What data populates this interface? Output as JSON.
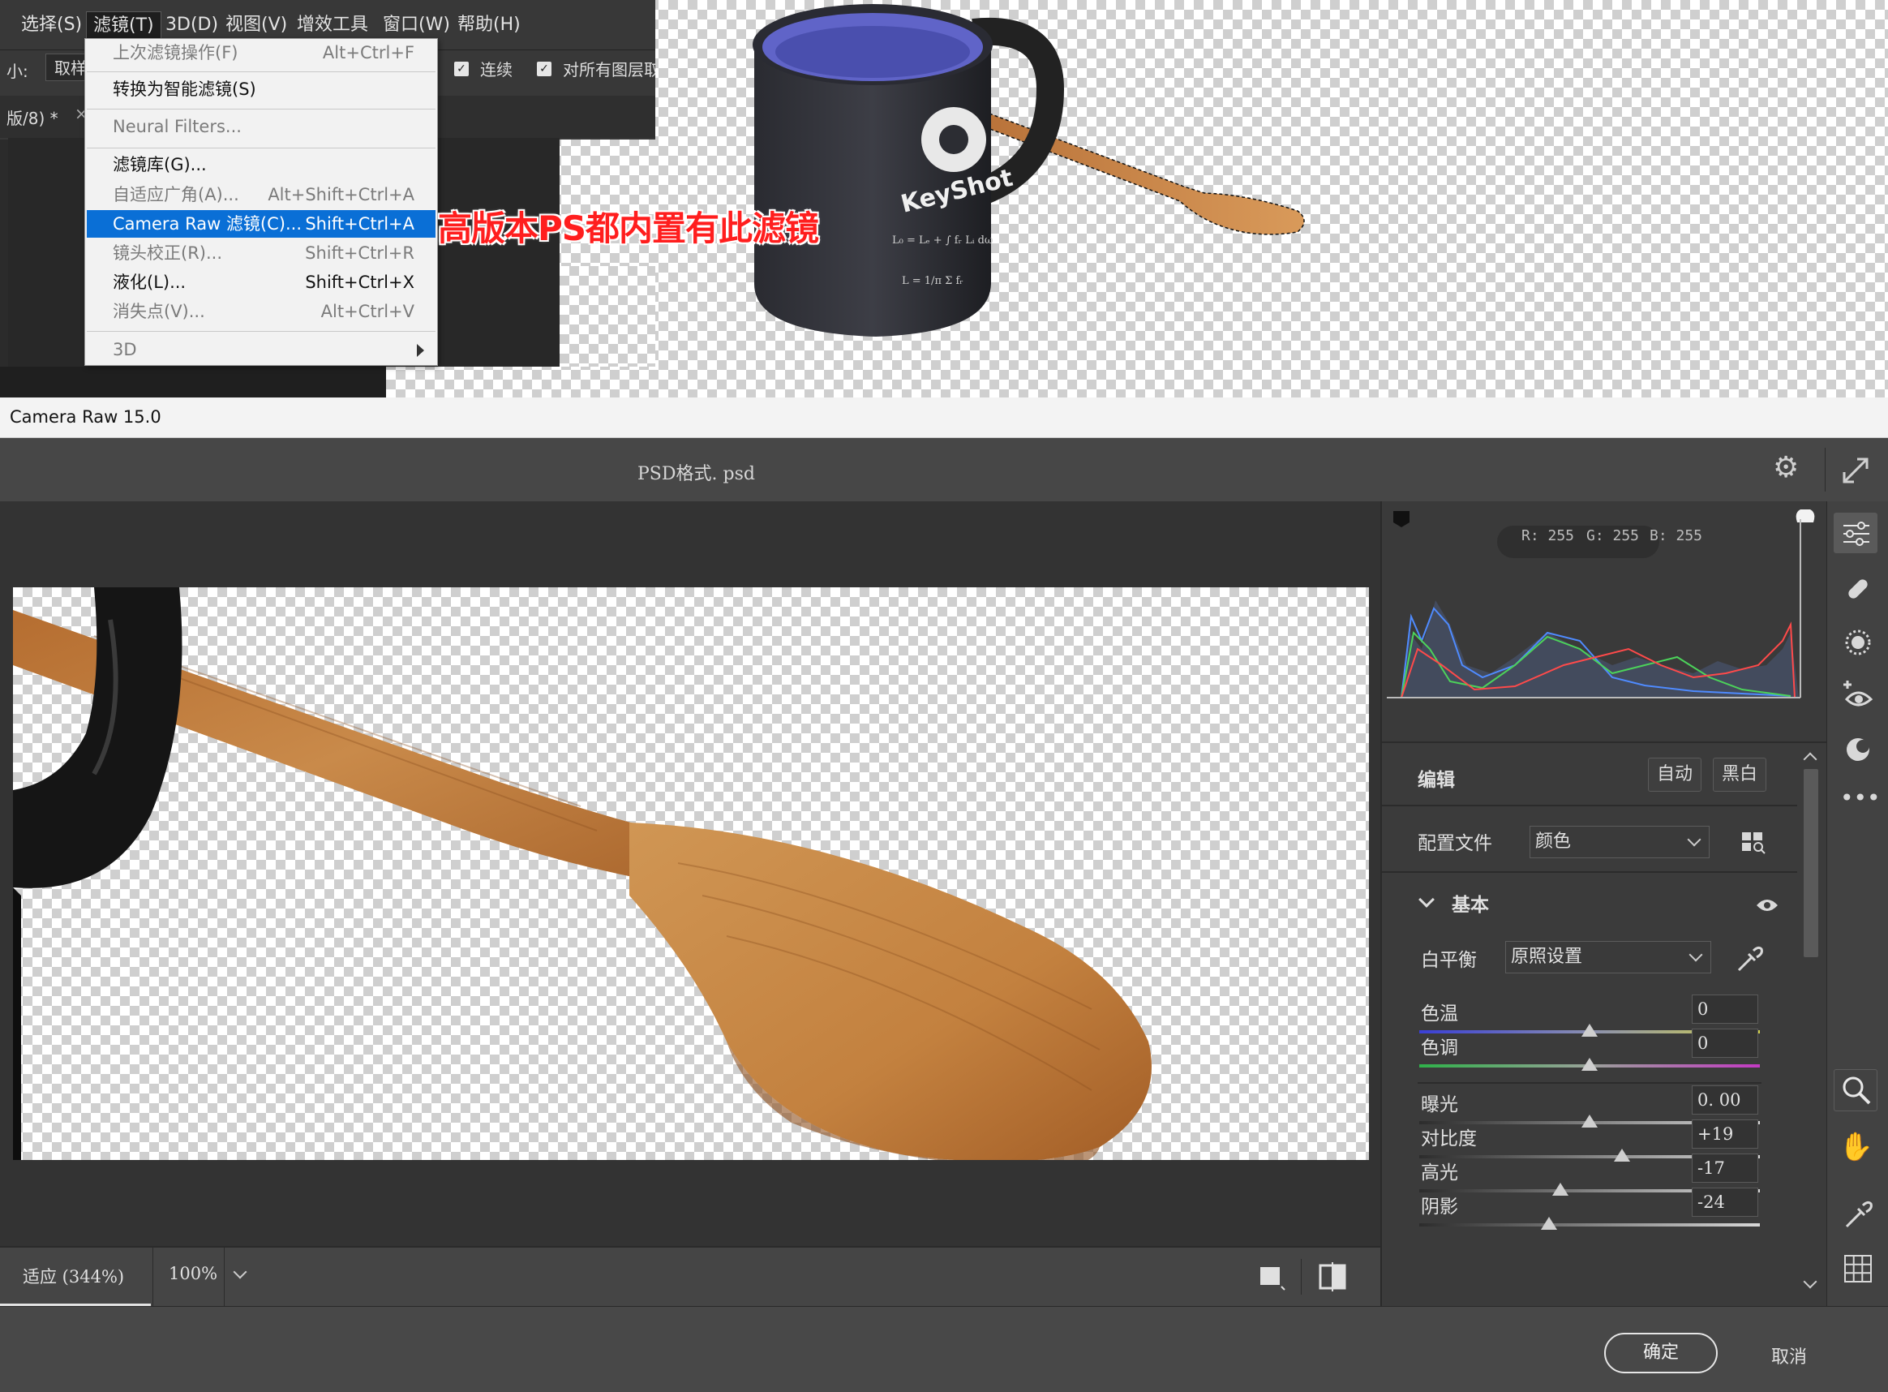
{
  "ps_menubar": {
    "items": [
      "选择(S)",
      "滤镜(T)",
      "3D(D)",
      "视图(V)",
      "增效工具",
      "窗口(W)",
      "帮助(H)"
    ]
  },
  "ps_options": {
    "size_label": "小:",
    "sample_button": "取样",
    "contiguous": "连续",
    "all_layers": "对所有图层取"
  },
  "ps_doc_tab": "版/8) *",
  "filter_menu": {
    "items": [
      {
        "label": "上次滤镜操作(F)",
        "shortcut": "Alt+Ctrl+F",
        "state": "disabled"
      },
      {
        "label": "转换为智能滤镜(S)",
        "shortcut": "",
        "state": "normal"
      },
      {
        "label": "Neural Filters...",
        "shortcut": "",
        "state": "disabled"
      },
      {
        "label": "滤镜库(G)...",
        "shortcut": "",
        "state": "normal"
      },
      {
        "label": "自适应广角(A)...",
        "shortcut": "Alt+Shift+Ctrl+A",
        "state": "disabled"
      },
      {
        "label": "Camera Raw 滤镜(C)...",
        "shortcut": "Shift+Ctrl+A",
        "state": "selected"
      },
      {
        "label": "镜头校正(R)...",
        "shortcut": "Shift+Ctrl+R",
        "state": "disabled"
      },
      {
        "label": "液化(L)...",
        "shortcut": "Shift+Ctrl+X",
        "state": "normal"
      },
      {
        "label": "消失点(V)...",
        "shortcut": "Alt+Ctrl+V",
        "state": "disabled"
      },
      {
        "label": "3D",
        "shortcut": "",
        "state": "disabled"
      }
    ]
  },
  "annotation": "高版本PS都内置有此滤镜",
  "mug": {
    "brand": "KeyShot"
  },
  "camera_raw": {
    "window_title": "Camera Raw 15.0",
    "filename": "PSD格式. psd",
    "rgb_readout": {
      "r": "R: 255",
      "g": "G: 255",
      "b": "B: 255"
    },
    "edit_label": "编辑",
    "auto_button": "自动",
    "bw_button": "黑白",
    "profile_label": "配置文件",
    "profile_value": "颜色",
    "section_basic": "基本",
    "wb_label": "白平衡",
    "wb_value": "原照设置",
    "sliders": [
      {
        "label": "色温",
        "value": "0",
        "pos": 0.5
      },
      {
        "label": "色调",
        "value": "0",
        "pos": 0.5
      },
      {
        "label": "曝光",
        "value": "0. 00",
        "pos": 0.5
      },
      {
        "label": "对比度",
        "value": "+19",
        "pos": 0.595
      },
      {
        "label": "高光",
        "value": "-17",
        "pos": 0.415
      },
      {
        "label": "阴影",
        "value": "-24",
        "pos": 0.38
      }
    ],
    "zoom_fit": "适应 (344%)",
    "zoom_100": "100%",
    "ok_button": "确定",
    "cancel_button": "取消"
  },
  "colors": {
    "accent_blue": "#0a6fd6",
    "annotation_red": "#ff1e1e",
    "panel_bg": "#3b3b3b"
  }
}
